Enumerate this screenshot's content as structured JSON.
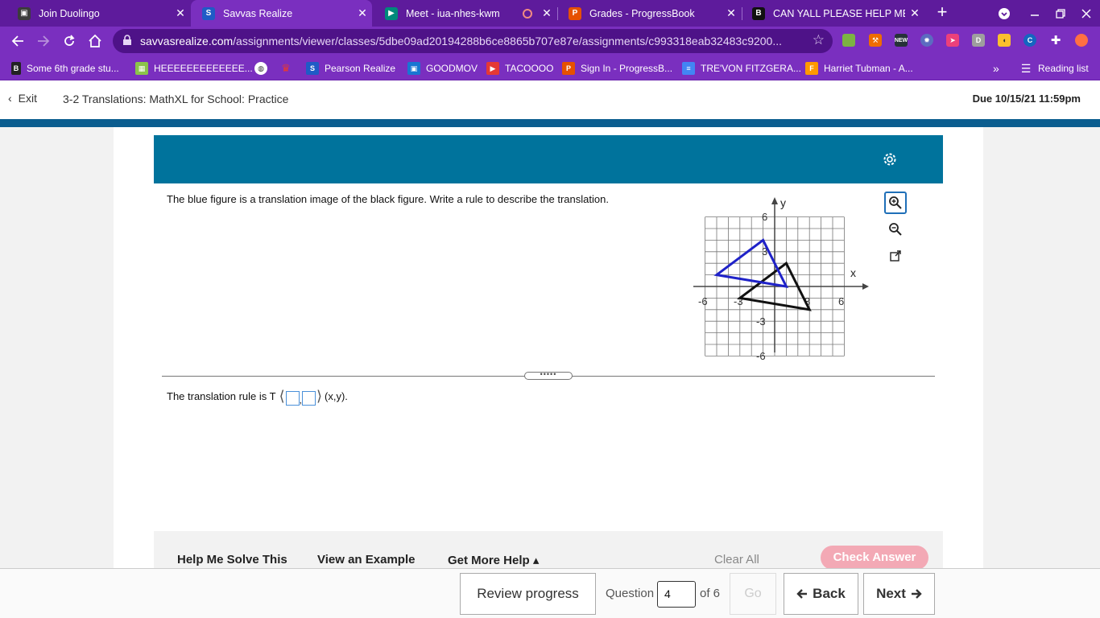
{
  "browser": {
    "tabs": [
      {
        "title": "Join Duolingo",
        "favicon": "classroom-icon",
        "color": "#3c3c3c"
      },
      {
        "title": "Savvas Realize",
        "favicon": "savvas-icon",
        "color": "#1f5bc6",
        "active": true
      },
      {
        "title": "Meet - iua-nhes-kwm",
        "favicon": "meet-icon",
        "color": "#00897b"
      },
      {
        "title": "Grades - ProgressBook",
        "favicon": "progressbook-icon",
        "color": "#e65100"
      },
      {
        "title": "CAN YALL PLEASE HELP ME!!",
        "favicon": "brainly-icon",
        "color": "#111111"
      }
    ],
    "url_domain": "savvasrealize.com",
    "url_path": "/assignments/viewer/classes/5dbe09ad20194288b6ce8865b707e87e/assignments/c993318eab32483c9200...",
    "bookmarks": [
      {
        "label": "Some 6th grade stu...",
        "icon": "b"
      },
      {
        "label": "HEEEEEEEEEEEEE...",
        "icon": "game"
      },
      {
        "label": "",
        "icon": "globe"
      },
      {
        "label": "",
        "icon": "crown"
      },
      {
        "label": "Pearson Realize",
        "icon": "savvas"
      },
      {
        "label": "GOODMOV",
        "icon": "film"
      },
      {
        "label": "TACOOOO",
        "icon": "youtube"
      },
      {
        "label": "Sign In - ProgressB...",
        "icon": "progressbook"
      },
      {
        "label": "TRE'VON FITZGERA...",
        "icon": "docs"
      },
      {
        "label": "Harriet Tubman - A...",
        "icon": "f"
      }
    ],
    "reading_list": "Reading list",
    "more_bookmarks": "»"
  },
  "header": {
    "exit_label": "Exit",
    "assignment_title": "3-2 Translations: MathXL for School: Practice",
    "due": "Due 10/15/21 11:59pm"
  },
  "question": {
    "prompt": "The blue figure is a translation image of the black figure. Write a rule to describe the translation.",
    "answer_prefix": "The translation rule is T",
    "answer_suffix": "(x,y).",
    "answer_separator": ",",
    "answer_open": "⟨",
    "answer_close": "⟩"
  },
  "graph": {
    "x_label": "x",
    "y_label": "y",
    "tick_labels": {
      "x_neg6": "-6",
      "x_neg3": "-3",
      "x_3": "3",
      "x_6": "6",
      "y_6": "6",
      "y_3": "3",
      "y_neg3": "-3",
      "y_neg6": "-6"
    },
    "range": [
      -6,
      6
    ],
    "black_triangle": [
      [
        -3,
        -1
      ],
      [
        1,
        2
      ],
      [
        3,
        -2
      ]
    ],
    "blue_triangle": [
      [
        -5,
        1
      ],
      [
        -1,
        4
      ],
      [
        1,
        0
      ]
    ],
    "colors": {
      "black": "#111111",
      "blue": "#1f22c8"
    }
  },
  "toolbar_help": {
    "help_solve": "Help Me Solve This",
    "view_example": "View an Example",
    "more_help": "Get More Help ▴",
    "clear_all": "Clear All",
    "check_answer": "Check Answer"
  },
  "footer": {
    "review": "Review progress",
    "question_label": "Question",
    "question_number": "4",
    "of_total": "of 6",
    "go": "Go",
    "back": "Back",
    "next": "Next"
  }
}
